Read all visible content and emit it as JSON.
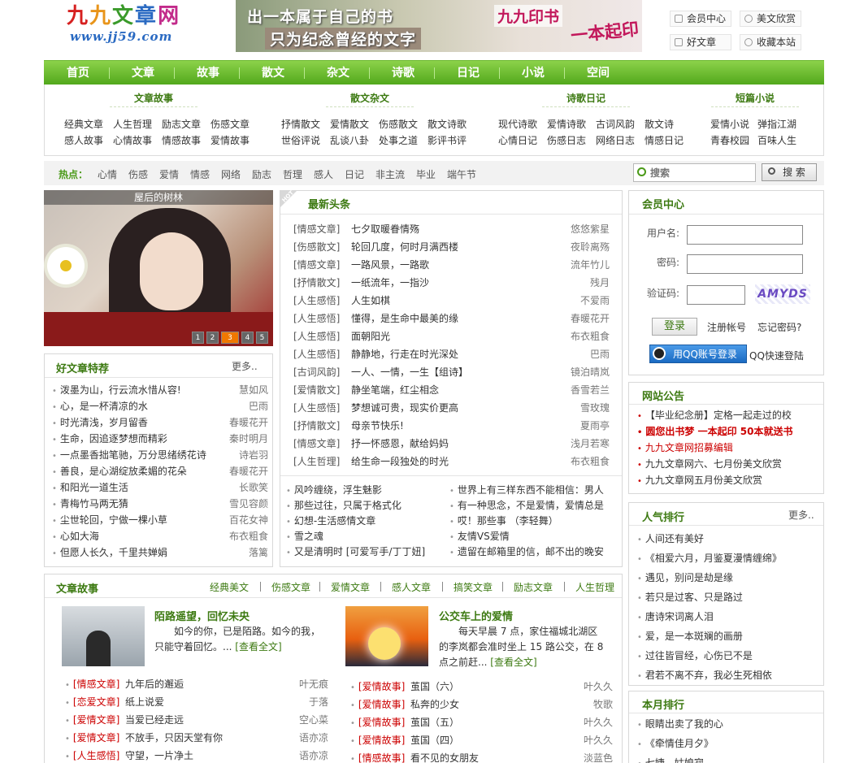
{
  "header": {
    "logo_text": "九九文章网",
    "logo_url_text": "www.jj59.com",
    "banner": {
      "line1": "出一本属于自己的书",
      "line2": "只为纪念曾经的文字",
      "brand": "九九印书",
      "slogan": "一本起印"
    },
    "top_links": [
      "会员中心",
      "美文欣赏",
      "好文章",
      "收藏本站"
    ]
  },
  "nav": [
    "首页",
    "文章",
    "故事",
    "散文",
    "杂文",
    "诗歌",
    "日记",
    "小说",
    "空间"
  ],
  "subnav": [
    {
      "title": "文章故事",
      "links": [
        "经典文章",
        "人生哲理",
        "励志文章",
        "伤感文章",
        "感人故事",
        "心情故事",
        "情感故事",
        "爱情故事"
      ]
    },
    {
      "title": "散文杂文",
      "links": [
        "抒情散文",
        "爱情散文",
        "伤感散文",
        "散文诗歌",
        "世俗评说",
        "乱谈八卦",
        "处事之道",
        "影评书评"
      ]
    },
    {
      "title": "诗歌日记",
      "links": [
        "现代诗歌",
        "爱情诗歌",
        "古词风韵",
        "散文诗",
        "心情日记",
        "伤感日志",
        "网络日志",
        "情感日记"
      ]
    },
    {
      "title": "短篇小说",
      "links": [
        "爱情小说",
        "弹指江湖",
        "青春校园",
        "百味人生"
      ]
    }
  ],
  "hotbar": {
    "label": "热点：",
    "keywords": [
      "心情",
      "伤感",
      "爱情",
      "情感",
      "网络",
      "励志",
      "哲理",
      "感人",
      "日记",
      "非主流",
      "毕业",
      "端午节"
    ],
    "search_placeholder": "搜索",
    "search_button": "搜 索"
  },
  "slideshow": {
    "caption": "屋后的树林",
    "pages": [
      "1",
      "2",
      "3",
      "4",
      "5"
    ],
    "active_page": 3
  },
  "good_articles": {
    "title": "好文章特荐",
    "more": "更多..",
    "items": [
      {
        "title": "泼墨为山，行云流水惜从容!",
        "author": "慧如风"
      },
      {
        "title": "心，是一杯清凉的水",
        "author": "巴雨"
      },
      {
        "title": "时光清浅，岁月留香",
        "author": "春暖花开"
      },
      {
        "title": "生命，因追逐梦想而精彩",
        "author": "秦时明月"
      },
      {
        "title": "一点墨香拙笔驰，万分思绪绣花诗",
        "author": "诗岩羽"
      },
      {
        "title": "善良，是心湖绽放柔媚的花朵",
        "author": "春暖花开"
      },
      {
        "title": "和阳光一道生活",
        "author": "长歌笑"
      },
      {
        "title": "青梅竹马两无猜",
        "author": "雪见容颜"
      },
      {
        "title": "尘世轮回，宁做一棵小草",
        "author": "百花女神"
      },
      {
        "title": "心如大海",
        "author": "布衣粗食"
      },
      {
        "title": "但愿人长久，千里共婵娟",
        "author": "落篱"
      }
    ]
  },
  "headlines": {
    "badge": "HOT",
    "title": "最新头条",
    "items": [
      {
        "cat": "[情感文章]",
        "title": "七夕取暖眷情殇",
        "author": "悠悠紫星"
      },
      {
        "cat": "[伤感散文]",
        "title": "轮回几度，何时月满西楼",
        "author": "夜聆离殇"
      },
      {
        "cat": "[情感文章]",
        "title": "一路风景，一路歌",
        "author": "流年竹儿"
      },
      {
        "cat": "[抒情散文]",
        "title": "一纸流年，一指沙",
        "author": "残月"
      },
      {
        "cat": "[人生感悟]",
        "title": "人生如棋",
        "author": "不爱雨"
      },
      {
        "cat": "[人生感悟]",
        "title": "懂得，是生命中最美的缘",
        "author": "春暖花开"
      },
      {
        "cat": "[人生感悟]",
        "title": "面朝阳光",
        "author": "布衣粗食"
      },
      {
        "cat": "[人生感悟]",
        "title": "静静地，行走在时光深处",
        "author": "巴雨"
      },
      {
        "cat": "[古词风韵]",
        "title": "一人、一情，一生【组诗】",
        "author": "镜泊晴岚"
      },
      {
        "cat": "[爱情散文]",
        "title": "静坐笔端，红尘相念",
        "author": "香雪若兰"
      },
      {
        "cat": "[人生感悟]",
        "title": "梦想诚可贵，现实价更高",
        "author": "雪玫瑰"
      },
      {
        "cat": "[抒情散文]",
        "title": "母亲节快乐!",
        "author": "夏雨亭"
      },
      {
        "cat": "[情感文章]",
        "title": "抒一怀感恩，献给妈妈",
        "author": "浅月若寒"
      },
      {
        "cat": "[人生哲理]",
        "title": "给生命一段独处的时光",
        "author": "布衣粗食"
      }
    ],
    "more_left": [
      "风吟缠绕，浮生魅影",
      "那些过往，只属于格式化",
      "幻想-生活感情文章",
      "雪之魂",
      "又是清明时 [可爱写手/丁丁妞]"
    ],
    "more_right": [
      "世界上有三样东西不能相信：男人",
      "有一种思念，不是爱情，爱情总是",
      "哎！那些事 （李轻舞）",
      "友情VS爱情",
      "遗留在邮箱里的信，邮不出的晚安"
    ]
  },
  "member": {
    "title": "会员中心",
    "username_label": "用户名:",
    "password_label": "密码:",
    "captcha_label": "验证码:",
    "captcha_text": "AMYDS",
    "login_button": "登录",
    "register_link": "注册帐号",
    "forgot_link": "忘记密码?",
    "qq_button": "用QQ账号登录",
    "qq_quick": "QQ快速登陆"
  },
  "announce": {
    "title": "网站公告",
    "items": [
      "【毕业纪念册】定格一起走过的校",
      "圆您出书梦  一本起印  50本就送书",
      "九九文章网招募编辑",
      "九九文章网六、七月份美文欣赏",
      "九九文章网五月份美文欣赏"
    ]
  },
  "popular": {
    "title": "人气排行",
    "more": "更多..",
    "items": [
      "人间还有美好",
      "《相爱六月，月鉴夏漫情缠绵》",
      "遇见，别问是劫是缘",
      "若只是过客、只是路过",
      "唐诗宋词离人泪",
      "爱，是一本斑斓的画册",
      "过往皆冒经，心伤已不是",
      "君若不离不弃，我必生死相依"
    ]
  },
  "monthly": {
    "title": "本月排行",
    "items": [
      "眼睛出卖了我的心",
      "《牵情佳月夕》",
      "七婕、姑娘寂"
    ]
  },
  "stories": {
    "title": "文章故事",
    "tabs": [
      "经典美文",
      "伤感文章",
      "爱情文章",
      "感人文章",
      "搞笑文章",
      "励志文章",
      "人生哲理"
    ],
    "featured": [
      {
        "title": "陌路遥望，回忆未央",
        "text": "如今的你，已是陌路。如今的我，只能守着回忆。...",
        "read": "[查看全文]"
      },
      {
        "title": "公交车上的爱情",
        "text": "每天早晨 7 点，家住福城北湖区的李岚都会准时坐上 15 路公交，在 8 点之前赶...",
        "read": "[查看全文]"
      }
    ],
    "left_list": [
      {
        "cat": "[情感文章]",
        "title": "九年后的邂逅",
        "author": "叶无痕"
      },
      {
        "cat": "[恋爱文章]",
        "title": "纸上说爱",
        "author": "于落"
      },
      {
        "cat": "[爱情文章]",
        "title": "当爱已经走远",
        "author": "空心菜"
      },
      {
        "cat": "[爱情文章]",
        "title": "不放手，只因天堂有你",
        "author": "语亦凉"
      },
      {
        "cat": "[人生感悟]",
        "title": "守望，一片净土",
        "author": "语亦凉"
      }
    ],
    "right_list": [
      {
        "cat": "[爱情故事]",
        "title": "茧国（六）",
        "author": "叶久久"
      },
      {
        "cat": "[爱情故事]",
        "title": "私奔的少女",
        "author": "牧歌"
      },
      {
        "cat": "[爱情故事]",
        "title": "茧国（五）",
        "author": "叶久久"
      },
      {
        "cat": "[爱情故事]",
        "title": "茧国（四）",
        "author": "叶久久"
      },
      {
        "cat": "[情感故事]",
        "title": "看不见的女朋友",
        "author": "淡蓝色"
      }
    ]
  }
}
